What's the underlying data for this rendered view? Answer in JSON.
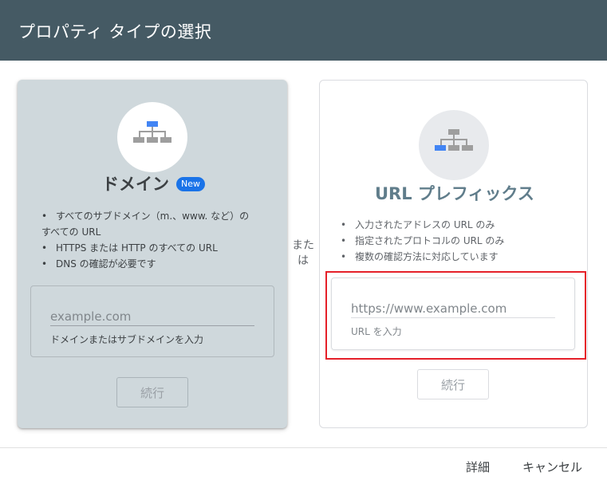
{
  "header": {
    "title": "プロパティ タイプの選択"
  },
  "domain_card": {
    "icon": "sitemap-icon",
    "title": "ドメイン",
    "badge": "New",
    "features": [
      "すべてのサブドメイン（m.、www. など）の",
      "すべての URL",
      "HTTPS または HTTP のすべての URL",
      "DNS の確認が必要です"
    ],
    "input_placeholder": "example.com",
    "input_help": "ドメインまたはサブドメインを入力",
    "continue_label": "続行"
  },
  "or_text_1": "また",
  "or_text_2": "は",
  "url_card": {
    "icon": "sitemap-icon",
    "title": "URL プレフィックス",
    "features": [
      "入力されたアドレスの URL のみ",
      "指定されたプロトコルの URL のみ",
      "複数の確認方法に対応しています"
    ],
    "input_placeholder": "https://www.example.com",
    "input_help": "URL を入力",
    "continue_label": "続行"
  },
  "footer": {
    "details_label": "詳細",
    "cancel_label": "キャンセル"
  },
  "colors": {
    "header_bg": "#455a64",
    "domain_card_bg": "#cfd8dc",
    "accent_blue": "#1a73e8",
    "highlight_red": "#e52029"
  }
}
